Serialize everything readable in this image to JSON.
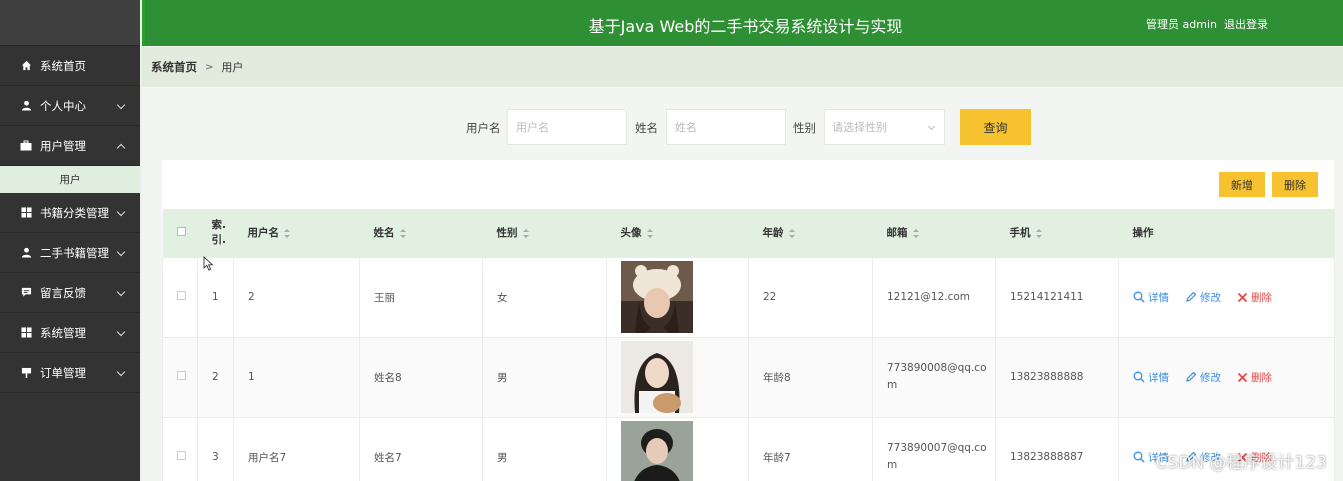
{
  "header": {
    "title": "基于Java Web的二手书交易系统设计与实现",
    "user_label": "管理员 admin",
    "logout_label": "退出登录",
    "bg_color": "#2f8f34"
  },
  "sidebar": {
    "items": [
      {
        "label": "系统首页",
        "icon": "home-icon",
        "chevron": "none"
      },
      {
        "label": "个人中心",
        "icon": "person-icon",
        "chevron": "down"
      },
      {
        "label": "用户管理",
        "icon": "briefcase-icon",
        "chevron": "up"
      },
      {
        "label": "书籍分类管理",
        "icon": "grid-icon",
        "chevron": "down"
      },
      {
        "label": "二手书籍管理",
        "icon": "person-icon",
        "chevron": "down"
      },
      {
        "label": "留言反馈",
        "icon": "chat-icon",
        "chevron": "down"
      },
      {
        "label": "系统管理",
        "icon": "grid-icon",
        "chevron": "down"
      },
      {
        "label": "订单管理",
        "icon": "pin-icon",
        "chevron": "down"
      }
    ],
    "subitem_user": "用户"
  },
  "breadcrumb": {
    "home": "系统首页",
    "separator": ">",
    "current": "用户"
  },
  "search": {
    "username_label": "用户名",
    "username_placeholder": "用户名",
    "name_label": "姓名",
    "name_placeholder": "姓名",
    "gender_label": "性别",
    "gender_placeholder": "请选择性别",
    "query_button": "查询"
  },
  "toolbar": {
    "add_button": "新增",
    "delete_button": "删除"
  },
  "table": {
    "columns": [
      "索引",
      "用户名",
      "姓名",
      "性别",
      "头像",
      "年龄",
      "邮箱",
      "手机",
      "操作"
    ],
    "index_label_line1": "索.",
    "index_label_line2": "引.",
    "rows": [
      {
        "index": "1",
        "username": "2",
        "name": "王丽",
        "gender": "女",
        "age": "22",
        "email": "12121@12.com",
        "phone": "15214121411"
      },
      {
        "index": "2",
        "username": "1",
        "name": "姓名8",
        "gender": "男",
        "age": "年龄8",
        "email": "773890008@qq.com",
        "phone": "13823888888"
      },
      {
        "index": "3",
        "username": "用户名7",
        "name": "姓名7",
        "gender": "男",
        "age": "年龄7",
        "email": "773890007@qq.com",
        "phone": "13823888887"
      }
    ],
    "op_detail": "详情",
    "op_edit": "修改",
    "op_delete": "删除"
  },
  "watermark": "CSDN @程序设计123",
  "colors": {
    "accent_yellow": "#f7c22f",
    "sidebar_bg": "#333333",
    "table_header_bg": "#e1f0e0",
    "link_blue": "#3a8ee6",
    "delete_red": "#e54848"
  }
}
